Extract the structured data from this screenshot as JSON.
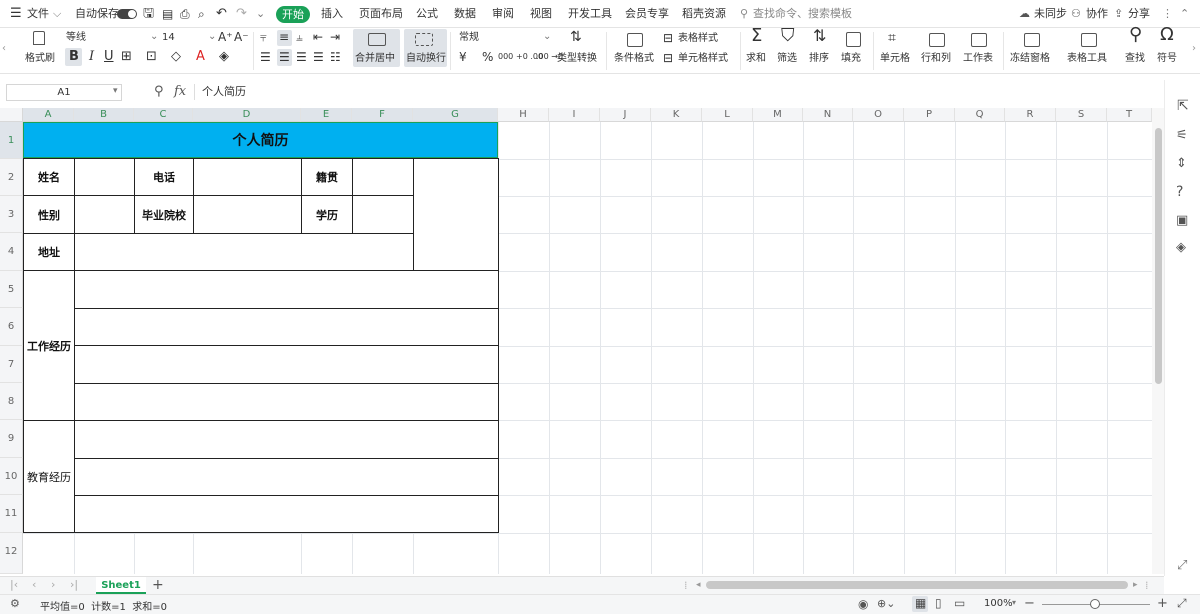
{
  "menubar": {
    "file": "文件",
    "autosave": "自动保存",
    "tabs": [
      "开始",
      "插入",
      "页面布局",
      "公式",
      "数据",
      "审阅",
      "视图",
      "开发工具",
      "会员专享",
      "稻壳资源"
    ],
    "search_placeholder": "查找命令、搜索模板",
    "sync": "未同步",
    "collab": "协作",
    "share": "分享"
  },
  "ribbon": {
    "format_painter": "格式刷",
    "font_name": "等线",
    "font_size": "14",
    "merge_center": "合并居中",
    "wrap_text": "自动换行",
    "number_format": "常规",
    "type_convert": "类型转换",
    "conditional_format": "条件格式",
    "table_style": "表格样式",
    "cell_style": "单元格样式",
    "sum": "求和",
    "filter": "筛选",
    "sort": "排序",
    "fill": "填充",
    "cells": "单元格",
    "rows_cols": "行和列",
    "worksheet": "工作表",
    "freeze": "冻结窗格",
    "table_tools": "表格工具",
    "find": "查找",
    "symbol": "符号",
    "bold": "B",
    "italic": "I",
    "underline": "U",
    "currency": "¥",
    "percent": "%",
    "thousands": "000",
    "dec_inc": "+0 .00",
    "dec_dec": ".00 →0"
  },
  "formula_bar": {
    "cell_ref": "A1",
    "fx": "fx",
    "content": "个人简历"
  },
  "columns": [
    "A",
    "B",
    "C",
    "D",
    "E",
    "F",
    "G",
    "H",
    "I",
    "J",
    "K",
    "L",
    "M",
    "N",
    "O",
    "P",
    "Q",
    "R",
    "S",
    "T"
  ],
  "rows": [
    "1",
    "2",
    "3",
    "4",
    "5",
    "6",
    "7",
    "8",
    "9",
    "10",
    "11",
    "12"
  ],
  "resume": {
    "title": "个人简历",
    "name": "姓名",
    "phone": "电话",
    "hometown": "籍贯",
    "gender": "性别",
    "school": "毕业院校",
    "education": "学历",
    "address": "地址",
    "work_exp": "工作经历",
    "edu_exp": "教育经历"
  },
  "sheet_tabs": {
    "active": "Sheet1",
    "add": "+"
  },
  "status": {
    "summary": "平均值=0  计数=1  求和=0",
    "zoom": "100%"
  },
  "colors": {
    "accent": "#1aa158",
    "title_fill": "#00b0f0"
  }
}
